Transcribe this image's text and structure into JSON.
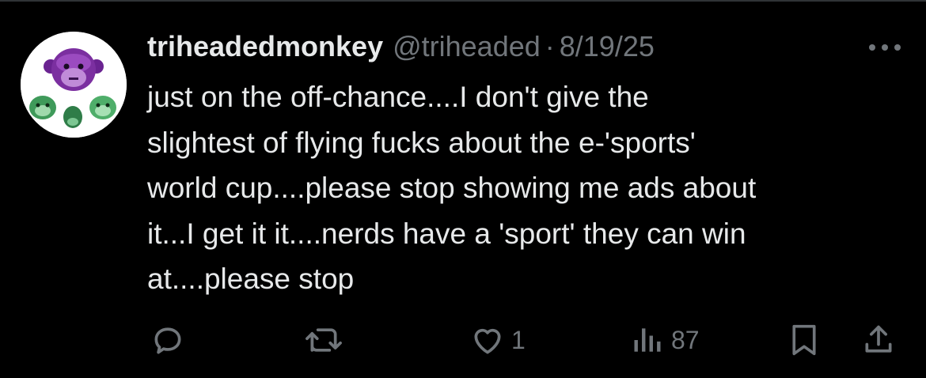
{
  "tweet": {
    "display_name": "triheadedmonkey",
    "handle": "@triheaded",
    "separator": "·",
    "date": "8/19/25",
    "text": "just on the off-chance....I don't give the\nslightest of flying fucks about the e-'sports'\nworld cup....please stop showing me ads about\nit...I get it it....nerds have a 'sport' they can win\nat....please stop"
  },
  "actions": {
    "reply_icon": "reply-icon",
    "retweet_icon": "retweet-icon",
    "like_icon": "heart-icon",
    "like_count": "1",
    "views_icon": "views-icon",
    "views_count": "87",
    "bookmark_icon": "bookmark-icon",
    "share_icon": "share-icon"
  },
  "colors": {
    "background": "#000000",
    "primary_text": "#e7e9ea",
    "secondary_text": "#71767b",
    "avatar_purple": "#7b2fa0",
    "avatar_green": "#4fae6a"
  }
}
